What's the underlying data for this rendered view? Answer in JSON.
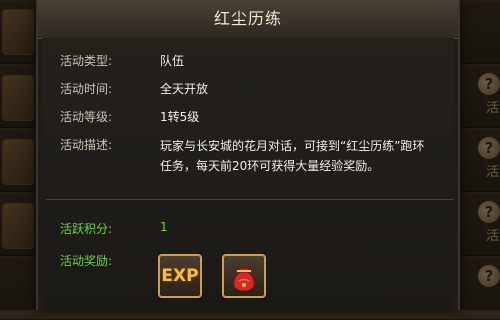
{
  "dialog": {
    "title": "红尘历练",
    "fields": {
      "type_label": "活动类型:",
      "type_value": "队伍",
      "time_label": "活动时间:",
      "time_value": "全天开放",
      "level_label": "活动等级:",
      "level_value": "1转5级",
      "desc_label": "活动描述:",
      "desc_value": "玩家与长安城的花月对话，可接到“红尘历练”跑环任务，每天前20环可获得大量经验奖励。",
      "points_label": "活跃积分:",
      "points_value": "1",
      "reward_label": "活动奖励:"
    },
    "rewards": {
      "exp_text": "EXP",
      "bag_icon": "red-pouch-icon"
    }
  },
  "background": {
    "right_icon_glyph": "?",
    "right_text": "活"
  },
  "colors": {
    "highlight_green": "#6fcf4a",
    "gold_border": "#c9a050"
  }
}
